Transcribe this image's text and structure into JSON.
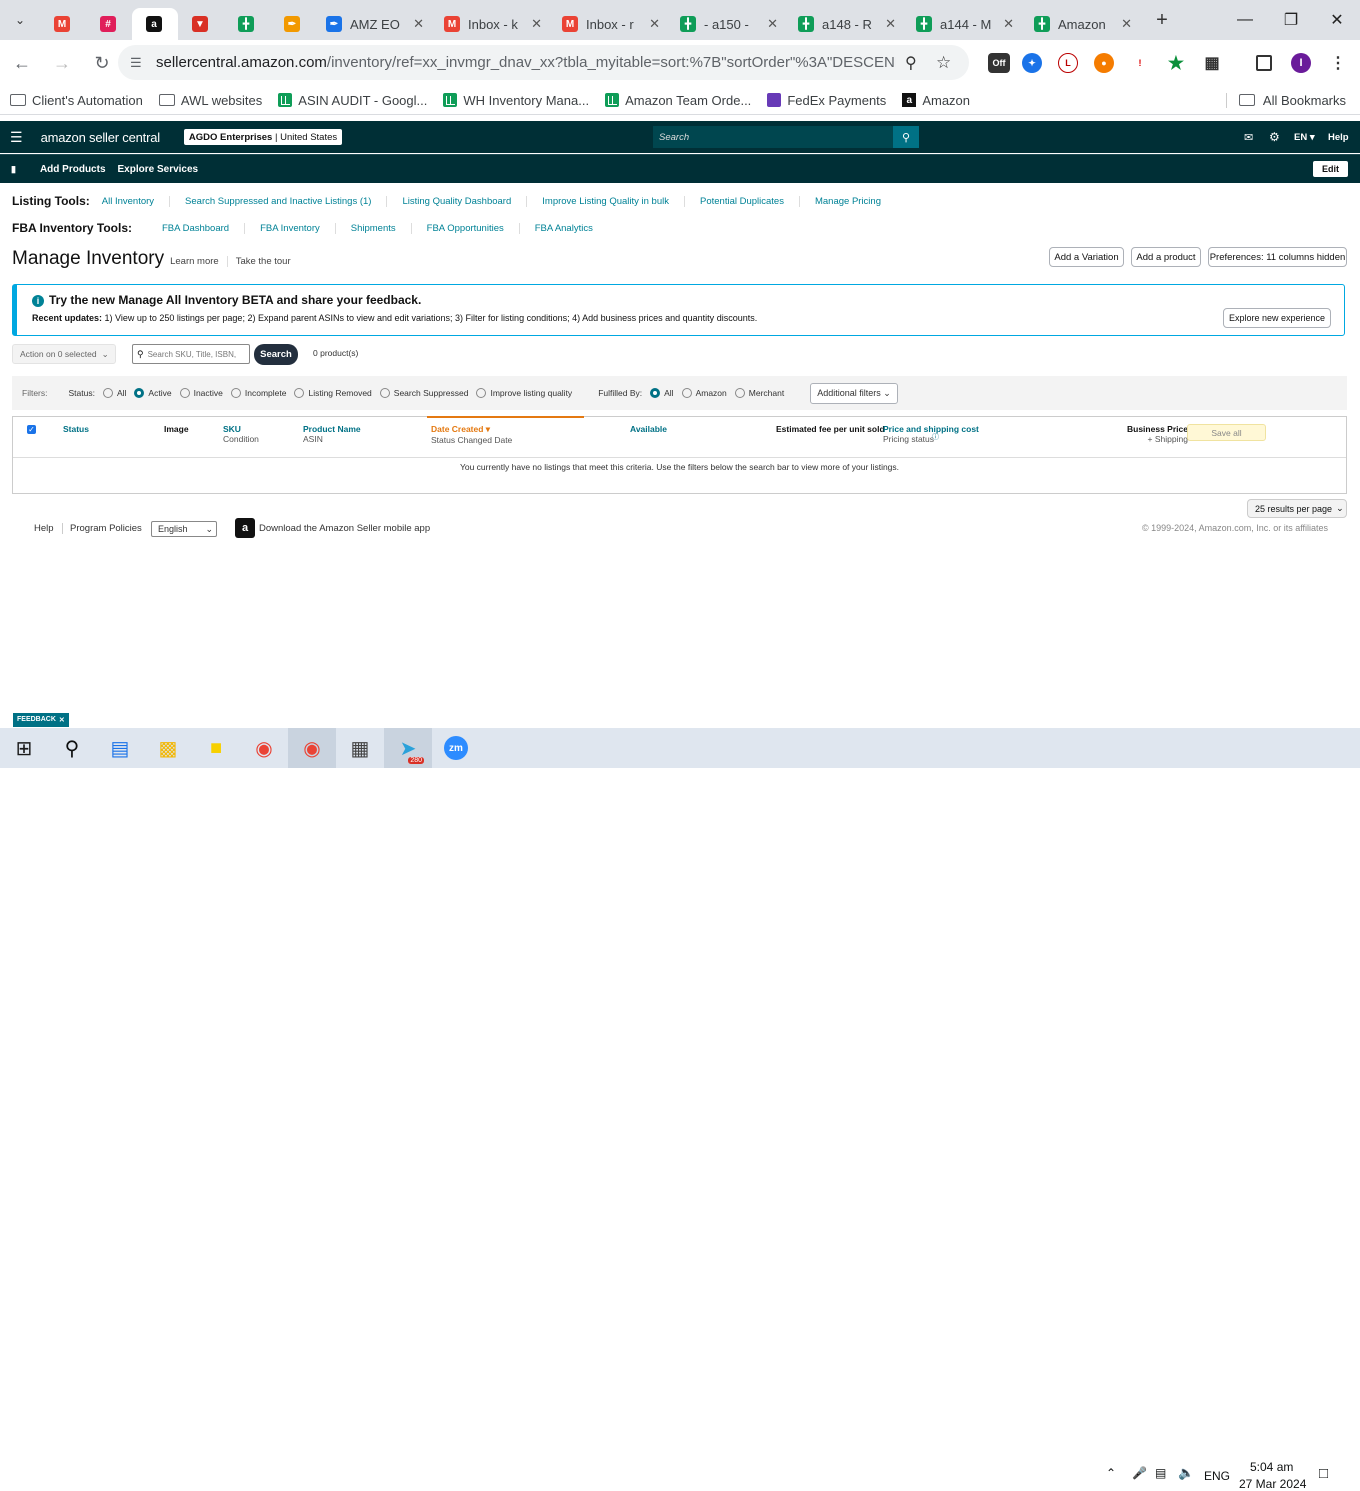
{
  "browser": {
    "tabs": [
      {
        "title": "",
        "favicon": "gmail-icon",
        "color": "#ea4335"
      },
      {
        "title": "",
        "favicon": "slack-icon",
        "color": "#e01e5a"
      },
      {
        "title": "",
        "favicon": "amazon-icon",
        "color": "#111111",
        "active": true
      },
      {
        "title": "",
        "favicon": "app-icon",
        "color": "#d93025"
      },
      {
        "title": "",
        "favicon": "sheets-icon",
        "color": "#0f9d58"
      },
      {
        "title": "",
        "favicon": "tool-icon",
        "color": "#f29900"
      },
      {
        "title": "AMZ EO",
        "favicon": "tool-icon",
        "color": "#1a73e8"
      },
      {
        "title": "Inbox - k",
        "favicon": "gmail-icon",
        "color": "#ea4335"
      },
      {
        "title": "Inbox - r",
        "favicon": "gmail-icon",
        "color": "#ea4335"
      },
      {
        "title": "- a150 -",
        "favicon": "sheets-icon",
        "color": "#0f9d58"
      },
      {
        "title": "a148 - R",
        "favicon": "sheets-icon",
        "color": "#0f9d58"
      },
      {
        "title": "a144 - M",
        "favicon": "sheets-icon",
        "color": "#0f9d58"
      },
      {
        "title": "Amazon",
        "favicon": "sheets-icon",
        "color": "#0f9d58"
      }
    ],
    "url_host": "sellercentral.amazon.com",
    "url_path": "/inventory/ref=xx_invmgr_dnav_xx?tbla_myitable=sort:%7B\"sortOrder\"%3A\"DESCENDING\"%2...",
    "bookmarks": [
      {
        "label": "Client's Automation",
        "icon": "folder-icon"
      },
      {
        "label": "AWL websites",
        "icon": "folder-icon"
      },
      {
        "label": "ASIN AUDIT - Googl...",
        "icon": "sheets-icon"
      },
      {
        "label": "WH Inventory Mana...",
        "icon": "sheets-icon"
      },
      {
        "label": "Amazon Team Orde...",
        "icon": "sheets-icon"
      },
      {
        "label": "FedEx Payments",
        "icon": "forms-icon"
      },
      {
        "label": "Amazon",
        "icon": "amazon-icon"
      }
    ],
    "all_bookmarks": "All Bookmarks",
    "profile_initial": "I",
    "ext_badge": "Off"
  },
  "header": {
    "logo": "amazon seller central",
    "account_name": "AGDO Enterprises",
    "marketplace": "United States",
    "search_placeholder": "Search",
    "language": "EN",
    "help": "Help"
  },
  "subnav": {
    "items": [
      "Add Products",
      "Explore Services"
    ],
    "edit": "Edit"
  },
  "listing_tools": {
    "label": "Listing Tools:",
    "links": [
      "All Inventory",
      "Search Suppressed and Inactive Listings (1)",
      "Listing Quality Dashboard",
      "Improve Listing Quality in bulk",
      "Potential Duplicates",
      "Manage Pricing"
    ]
  },
  "fba_tools": {
    "label": "FBA Inventory Tools:",
    "links": [
      "FBA Dashboard",
      "FBA Inventory",
      "Shipments",
      "FBA Opportunities",
      "FBA Analytics"
    ]
  },
  "page": {
    "title": "Manage Inventory",
    "learn_more": "Learn more",
    "take_tour": "Take the tour",
    "add_variation": "Add a Variation",
    "add_product": "Add a product",
    "preferences": "Preferences: 11 columns hidden"
  },
  "banner": {
    "heading": "Try the new Manage All Inventory BETA and share your feedback.",
    "updates_label": "Recent updates:",
    "updates_text": " 1) View up to 250 listings per page; 2) Expand parent ASINs to view and edit variations; 3) Filter for listing conditions; 4) Add business prices and quantity discounts.",
    "button": "Explore new experience"
  },
  "search_row": {
    "action": "Action on 0 selected",
    "placeholder": "Search SKU, Title, ISBN,",
    "search_button": "Search",
    "count": "0 product(s)"
  },
  "filters": {
    "label": "Filters:",
    "status_label": "Status:",
    "status_options": [
      "All",
      "Active",
      "Inactive",
      "Incomplete",
      "Listing Removed",
      "Search Suppressed",
      "Improve listing quality"
    ],
    "status_selected": "Active",
    "fulfilled_label": "Fulfilled By:",
    "fulfilled_options": [
      "All",
      "Amazon",
      "Merchant"
    ],
    "fulfilled_selected": "All",
    "additional": "Additional filters"
  },
  "table": {
    "columns": [
      {
        "title": "Status",
        "sub": ""
      },
      {
        "title": "Image",
        "sub": ""
      },
      {
        "title": "SKU",
        "sub": "Condition"
      },
      {
        "title": "Product Name",
        "sub": "ASIN"
      },
      {
        "title": "Date Created ▾",
        "sub": "Status Changed Date"
      },
      {
        "title": "Available",
        "sub": ""
      },
      {
        "title": "Estimated fee per unit sold",
        "sub": ""
      },
      {
        "title": "Price and shipping cost",
        "sub": "Pricing status"
      },
      {
        "title": "Business Price",
        "sub": "+ Shipping"
      }
    ],
    "save_all": "Save all",
    "empty_message": "You currently have no listings that meet this criteria. Use the filters below the search bar to view more of your listings.",
    "per_page": "25 results per page"
  },
  "footer": {
    "help": "Help",
    "policies": "Program Policies",
    "language": "English",
    "app": "Download the Amazon Seller mobile app",
    "copyright": "© 1999-2024, Amazon.com, Inc. or its affiliates",
    "feedback": "FEEDBACK"
  },
  "taskbar": {
    "time": "5:04 am",
    "date": "27 Mar 2024",
    "lang": "ENG",
    "telegram_badge": "280"
  }
}
